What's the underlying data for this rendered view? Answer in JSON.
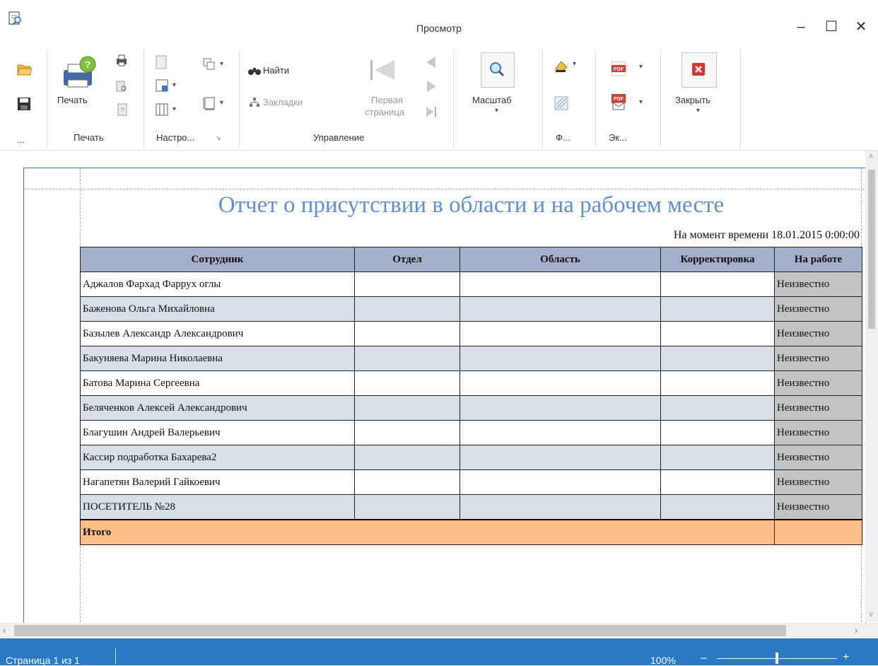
{
  "window": {
    "title": "Просмотр",
    "minimize": "–",
    "maximize": "☐",
    "close": "✕"
  },
  "ribbon": {
    "file_group_label": "...",
    "print_group": {
      "label": "Печать",
      "print_button": "Печать"
    },
    "settings_group": {
      "label": "Настро..."
    },
    "nav_group": {
      "label": "Управление",
      "find": "Найти",
      "bookmarks": "Закладки",
      "first_page_line1": "Первая",
      "first_page_line2": "страница"
    },
    "zoom_group": {
      "zoom_button": "Масштаб"
    },
    "format_group": {
      "label": "Ф..."
    },
    "export_group": {
      "label": "Эк..."
    },
    "close_group": {
      "close_button": "Закрыть"
    }
  },
  "report": {
    "title": "Отчет о присутствии в области и на рабочем месте",
    "moment": "На момент времени 18.01.2015 0:00:00",
    "columns": [
      "Сотрудник",
      "Отдел",
      "Область",
      "Корректировка",
      "На работе"
    ],
    "rows": [
      {
        "employee": "Аджалов Фархад Фаррух оглы",
        "status": "Неизвестно"
      },
      {
        "employee": "Баженова Ольга Михайловна",
        "status": "Неизвестно"
      },
      {
        "employee": "Базылев Александр Александрович",
        "status": "Неизвестно"
      },
      {
        "employee": "Бакуняева Марина Николаевна",
        "status": "Неизвестно"
      },
      {
        "employee": "Батова Марина Сергеевна",
        "status": "Неизвестно"
      },
      {
        "employee": "Беляченков Алексей Александрович",
        "status": "Неизвестно"
      },
      {
        "employee": "Благушин Андрей Валерьевич",
        "status": "Неизвестно"
      },
      {
        "employee": "Кассир подработка Бахарева2",
        "status": "Неизвестно"
      },
      {
        "employee": "Нагапетян Валерий Гайкоевич",
        "status": "Неизвестно"
      },
      {
        "employee": "ПОСЕТИТЕЛЬ №28",
        "status": "Неизвестно"
      }
    ],
    "total_label": "Итого"
  },
  "statusbar": {
    "page_info": "Страница 1 из 1",
    "zoom": "100%",
    "zoom_out": "–",
    "zoom_in": "+",
    "zoom_level": 0.5
  },
  "colors": {
    "accent": "#2b78c5",
    "title": "#5e8fd8",
    "header": "#a4b0c9",
    "alt_row": "#d9dfe8",
    "total": "#ffbf86",
    "status_cell": "#c3c3c3"
  }
}
